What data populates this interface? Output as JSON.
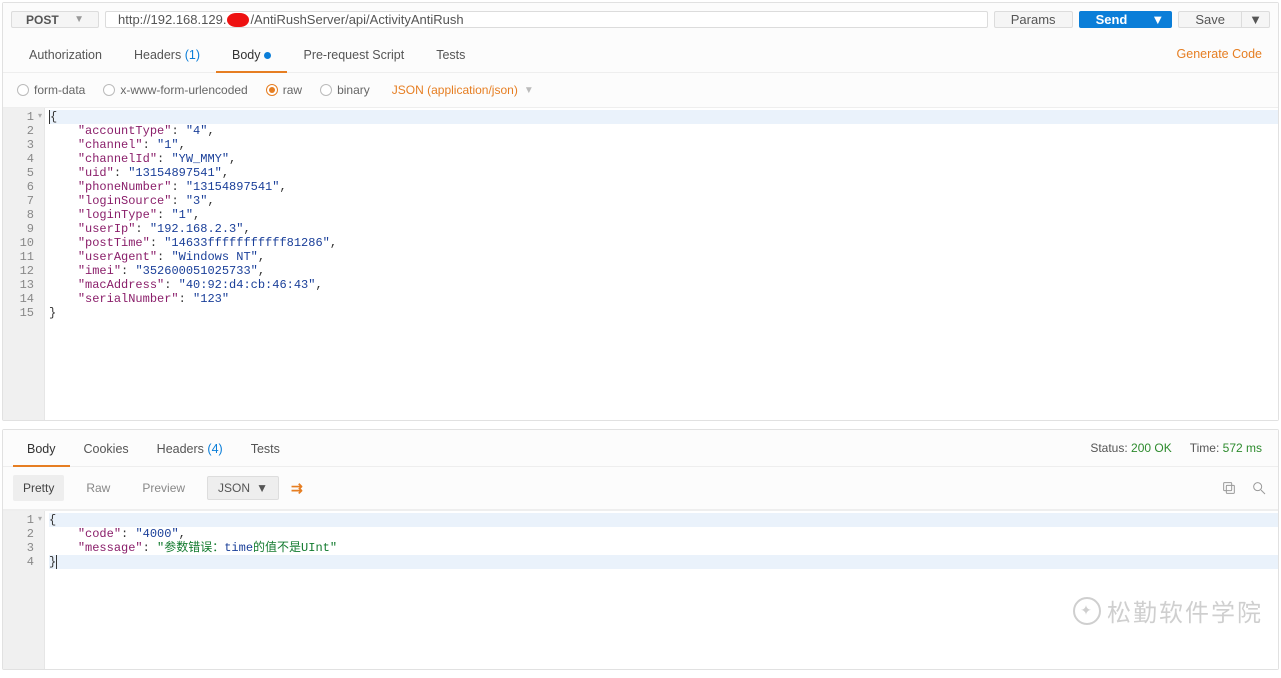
{
  "request": {
    "method": "POST",
    "url_prefix": "http://192.168.129.",
    "url_suffix": "/AntiRushServer/api/ActivityAntiRush",
    "params_btn": "Params",
    "send_btn": "Send",
    "save_btn": "Save"
  },
  "req_tabs": {
    "authorization": "Authorization",
    "headers": "Headers",
    "headers_count": "(1)",
    "body": "Body",
    "prerequest": "Pre-request Script",
    "tests": "Tests",
    "generate_code": "Generate Code"
  },
  "body_opts": {
    "form_data": "form-data",
    "urlencoded": "x-www-form-urlencoded",
    "raw": "raw",
    "binary": "binary",
    "content_type": "JSON (application/json)"
  },
  "req_body_lines": [
    "{",
    "    \"accountType\": \"4\",",
    "    \"channel\": \"1\",",
    "    \"channelId\": \"YW_MMY\",",
    "    \"uid\": \"13154897541\",",
    "    \"phoneNumber\": \"13154897541\",",
    "    \"loginSource\": \"3\",",
    "    \"loginType\": \"1\",",
    "    \"userIp\": \"192.168.2.3\",",
    "    \"postTime\": \"14633fffffffffff81286\",",
    "    \"userAgent\": \"Windows NT\",",
    "    \"imei\": \"352600051025733\",",
    "    \"macAddress\": \"40:92:d4:cb:46:43\",",
    "    \"serialNumber\": \"123\"",
    "}"
  ],
  "resp_tabs": {
    "body": "Body",
    "cookies": "Cookies",
    "headers": "Headers",
    "headers_count": "(4)",
    "tests": "Tests"
  },
  "resp_status": {
    "status_label": "Status:",
    "status_value": "200 OK",
    "time_label": "Time:",
    "time_value": "572 ms"
  },
  "resp_toolbar": {
    "pretty": "Pretty",
    "raw": "Raw",
    "preview": "Preview",
    "format": "JSON"
  },
  "resp_body": {
    "line1": "{",
    "code_key": "\"code\"",
    "code_val": "\"4000\"",
    "msg_key": "\"message\"",
    "msg_prefix": "\"参数错误：",
    "msg_mid": "time",
    "msg_suffix": "的值不是UInt\"",
    "line4": "}"
  },
  "watermark": "松勤软件学院"
}
